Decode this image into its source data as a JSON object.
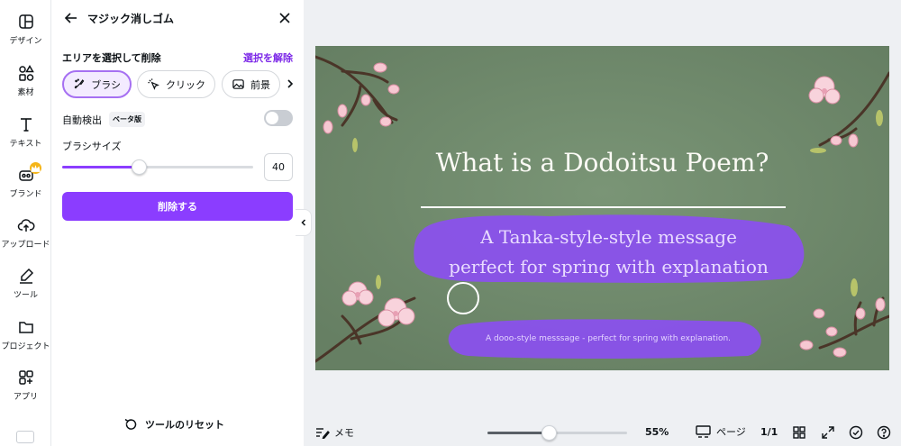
{
  "rail": {
    "items": [
      {
        "label": "デザイン",
        "icon": "layout-icon"
      },
      {
        "label": "素材",
        "icon": "shapes-icon"
      },
      {
        "label": "テキスト",
        "icon": "text-icon"
      },
      {
        "label": "ブランド",
        "icon": "brand-icon"
      },
      {
        "label": "アップロード",
        "icon": "cloud-upload-icon"
      },
      {
        "label": "ツール",
        "icon": "pen-tool-icon"
      },
      {
        "label": "プロジェクト",
        "icon": "folder-icon"
      },
      {
        "label": "アプリ",
        "icon": "apps-icon"
      }
    ]
  },
  "panel": {
    "title": "マジック消しゴム",
    "section_label": "エリアを選択して削除",
    "deselect_label": "選択を解除",
    "modes": [
      {
        "label": "ブラシ",
        "icon": "brush-icon",
        "active": true
      },
      {
        "label": "クリック",
        "icon": "magic-click-icon",
        "active": false
      },
      {
        "label": "前景",
        "icon": "image-icon",
        "active": false
      }
    ],
    "auto_detect_label": "自動検出",
    "beta_label": "ベータ版",
    "auto_detect_on": false,
    "brush_size_label": "ブラシサイズ",
    "brush_size": "40",
    "brush_size_fraction": 0.4,
    "erase_button_label": "削除する",
    "reset_label": "ツールのリセット"
  },
  "slide": {
    "title": "What is a  Dodoitsu Poem?",
    "subtitle_line1": "A  Tanka-style-style message",
    "subtitle_line2": "perfect for spring with explanation",
    "caption": "A dooo-style messsage - perfect for spring with explanation."
  },
  "bottom_bar": {
    "memo_label": "メモ",
    "zoom_value": "55%",
    "zoom_fraction": 0.44,
    "pages_label": "ページ",
    "page_count": "1/1"
  },
  "colors": {
    "accent": "#8b3dff",
    "slide_bg": "#6f8b6b",
    "brush_highlight": "#8b4ff0"
  }
}
